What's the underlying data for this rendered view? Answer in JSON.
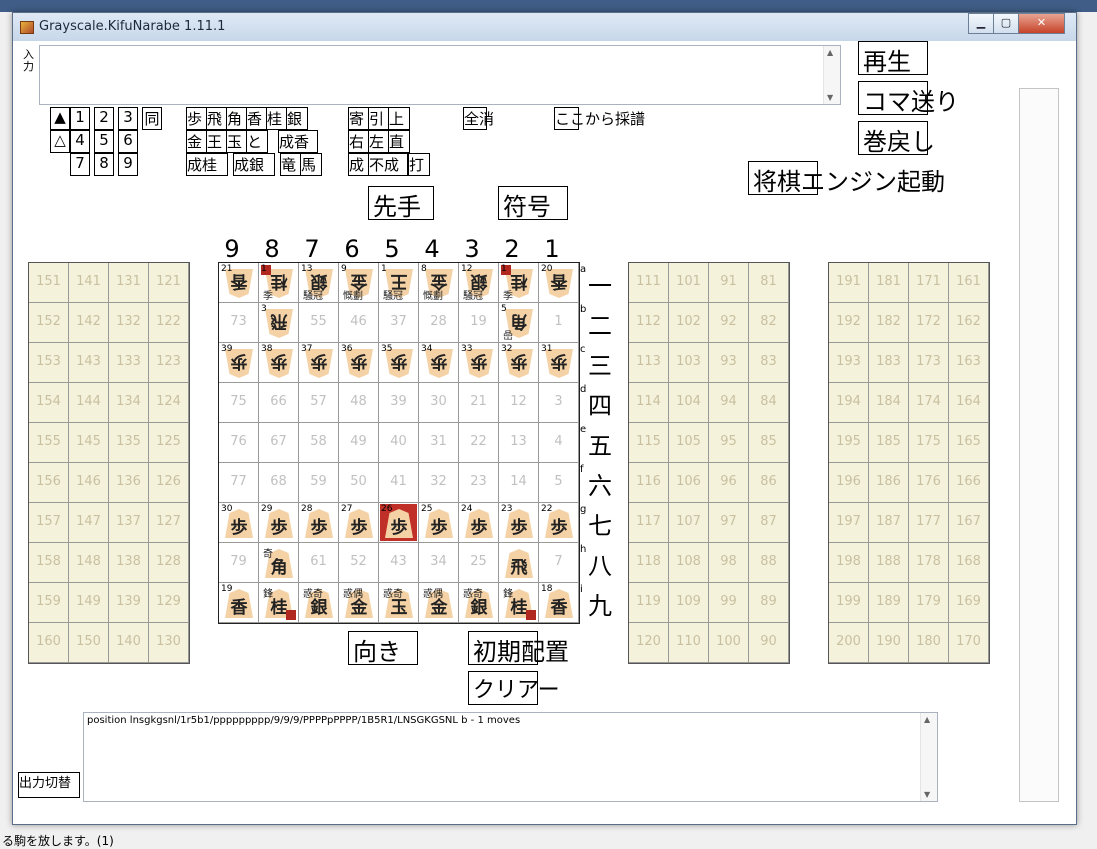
{
  "window": {
    "title": "Grayscale.KifuNarabe 1.11.1",
    "min": "▁",
    "max": "▢",
    "close": "✕"
  },
  "input": {
    "label": "入力",
    "value": ""
  },
  "num_buttons": [
    "▲",
    "1",
    "2",
    "3",
    "同",
    "△",
    "4",
    "5",
    "6",
    "7",
    "8",
    "9"
  ],
  "piece_buttons": [
    "歩",
    "飛",
    "角",
    "香",
    "桂",
    "銀",
    "金",
    "王",
    "玉",
    "と",
    "成香",
    "成桂",
    "成銀",
    "竜",
    "馬"
  ],
  "mod_buttons": [
    "寄",
    "引",
    "上",
    "右",
    "左",
    "直",
    "成",
    "不成",
    "打"
  ],
  "ctrl": {
    "zenkesu": "全消",
    "kokokara": "ここから採譜",
    "sente": "先手",
    "fugo": "符号",
    "muki": "向き",
    "shoki": "初期配置",
    "clear": "クリアー",
    "output_toggle": "出力切替"
  },
  "right_buttons": {
    "play": "再生",
    "koma": "コマ送り",
    "maki": "巻戻し",
    "engine": "将棋エンジン起動"
  },
  "col_numbers": [
    "9",
    "8",
    "7",
    "6",
    "5",
    "4",
    "3",
    "2",
    "1"
  ],
  "row_kanji": [
    "一",
    "二",
    "三",
    "四",
    "五",
    "六",
    "七",
    "八",
    "九"
  ],
  "row_letters": [
    "a",
    "b",
    "c",
    "d",
    "e",
    "f",
    "g",
    "h",
    "i"
  ],
  "board": [
    [
      {
        "l": "21",
        "p": "香",
        "r": true
      },
      {
        "l": "1",
        "p": "桂",
        "r": true,
        "x": "季",
        "c": true
      },
      {
        "l": "13",
        "p": "銀",
        "r": true,
        "x": "騒冠"
      },
      {
        "l": "9",
        "p": "金",
        "r": true,
        "x": "慨劃"
      },
      {
        "l": "1",
        "p": "王",
        "r": true,
        "x": "騒冠"
      },
      {
        "l": "8",
        "p": "金",
        "r": true,
        "x": "慨劃"
      },
      {
        "l": "12",
        "p": "銀",
        "r": true,
        "x": "騒冠"
      },
      {
        "l": "1",
        "p": "桂",
        "r": true,
        "x": "季",
        "c": true
      },
      {
        "l": "20",
        "p": "香",
        "r": true
      }
    ],
    [
      {
        "n": "73"
      },
      {
        "l": "3",
        "p": "飛",
        "r": true
      },
      {
        "n": "55"
      },
      {
        "n": "46"
      },
      {
        "n": "37"
      },
      {
        "n": "28"
      },
      {
        "n": "19"
      },
      {
        "l": "5",
        "p": "角",
        "r": true,
        "x": "嵒"
      },
      {
        "n": "1"
      }
    ],
    [
      {
        "l": "39",
        "p": "歩",
        "r": true
      },
      {
        "l": "38",
        "p": "歩",
        "r": true
      },
      {
        "l": "37",
        "p": "歩",
        "r": true
      },
      {
        "l": "36",
        "p": "歩",
        "r": true
      },
      {
        "l": "35",
        "p": "歩",
        "r": true
      },
      {
        "l": "34",
        "p": "歩",
        "r": true
      },
      {
        "l": "33",
        "p": "歩",
        "r": true
      },
      {
        "l": "32",
        "p": "歩",
        "r": true
      },
      {
        "l": "31",
        "p": "歩",
        "r": true
      }
    ],
    [
      {
        "n": "75"
      },
      {
        "n": "66"
      },
      {
        "n": "57"
      },
      {
        "n": "48"
      },
      {
        "n": "39"
      },
      {
        "n": "30"
      },
      {
        "n": "21"
      },
      {
        "n": "12"
      },
      {
        "n": "3"
      }
    ],
    [
      {
        "n": "76"
      },
      {
        "n": "67"
      },
      {
        "n": "58"
      },
      {
        "n": "49"
      },
      {
        "n": "40"
      },
      {
        "n": "31"
      },
      {
        "n": "22"
      },
      {
        "n": "13"
      },
      {
        "n": "4"
      }
    ],
    [
      {
        "n": "77"
      },
      {
        "n": "68"
      },
      {
        "n": "59"
      },
      {
        "n": "50"
      },
      {
        "n": "41"
      },
      {
        "n": "32"
      },
      {
        "n": "23"
      },
      {
        "n": "14"
      },
      {
        "n": "5"
      }
    ],
    [
      {
        "l": "30",
        "p": "歩"
      },
      {
        "l": "29",
        "p": "歩"
      },
      {
        "l": "28",
        "p": "歩"
      },
      {
        "l": "27",
        "p": "歩"
      },
      {
        "l": "26",
        "p": "歩",
        "h": true
      },
      {
        "l": "25",
        "p": "歩"
      },
      {
        "l": "24",
        "p": "歩"
      },
      {
        "l": "23",
        "p": "歩"
      },
      {
        "l": "22",
        "p": "歩"
      }
    ],
    [
      {
        "n": "79"
      },
      {
        "p": "角",
        "x": "奇"
      },
      {
        "n": "61"
      },
      {
        "n": "52"
      },
      {
        "n": "43"
      },
      {
        "n": "34"
      },
      {
        "n": "25"
      },
      {
        "p": "飛"
      },
      {
        "n": "7"
      }
    ],
    [
      {
        "l": "19",
        "p": "香"
      },
      {
        "p": "桂",
        "x": "鋒",
        "c": true
      },
      {
        "p": "銀",
        "x": "惑奇"
      },
      {
        "p": "金",
        "x": "惑偶"
      },
      {
        "p": "玉",
        "x": "惑奇"
      },
      {
        "p": "金",
        "x": "惑偶"
      },
      {
        "p": "銀",
        "x": "惑奇"
      },
      {
        "p": "桂",
        "x": "鋒",
        "c": true
      },
      {
        "l": "18",
        "p": "香"
      }
    ]
  ],
  "left_stand": [
    [
      "151",
      "141",
      "131",
      "121"
    ],
    [
      "152",
      "142",
      "132",
      "122"
    ],
    [
      "153",
      "143",
      "133",
      "123"
    ],
    [
      "154",
      "144",
      "134",
      "124"
    ],
    [
      "155",
      "145",
      "135",
      "125"
    ],
    [
      "156",
      "146",
      "136",
      "126"
    ],
    [
      "157",
      "147",
      "137",
      "127"
    ],
    [
      "158",
      "148",
      "138",
      "128"
    ],
    [
      "159",
      "149",
      "139",
      "129"
    ],
    [
      "160",
      "150",
      "140",
      "130"
    ]
  ],
  "mid_stand": [
    [
      "111",
      "101",
      "91",
      "81"
    ],
    [
      "112",
      "102",
      "92",
      "82"
    ],
    [
      "113",
      "103",
      "93",
      "83"
    ],
    [
      "114",
      "104",
      "94",
      "84"
    ],
    [
      "115",
      "105",
      "95",
      "85"
    ],
    [
      "116",
      "106",
      "96",
      "86"
    ],
    [
      "117",
      "107",
      "97",
      "87"
    ],
    [
      "118",
      "108",
      "98",
      "88"
    ],
    [
      "119",
      "109",
      "99",
      "89"
    ],
    [
      "120",
      "110",
      "100",
      "90"
    ]
  ],
  "right_stand": [
    [
      "191",
      "181",
      "171",
      "161"
    ],
    [
      "192",
      "182",
      "172",
      "162"
    ],
    [
      "193",
      "183",
      "173",
      "163"
    ],
    [
      "194",
      "184",
      "174",
      "164"
    ],
    [
      "195",
      "185",
      "175",
      "165"
    ],
    [
      "196",
      "186",
      "176",
      "166"
    ],
    [
      "197",
      "187",
      "177",
      "167"
    ],
    [
      "198",
      "188",
      "178",
      "168"
    ],
    [
      "199",
      "189",
      "179",
      "169"
    ],
    [
      "200",
      "190",
      "180",
      "170"
    ]
  ],
  "position_text": "position lnsgkgsnl/1r5b1/ppppppppp/9/9/9/PPPPpPPPP/1B5R1/LNSGKGSNL b - 1 moves",
  "colors": {
    "piece": "#f4d2a6",
    "stand": "#f5f2dc",
    "highlight": "#c03028"
  }
}
